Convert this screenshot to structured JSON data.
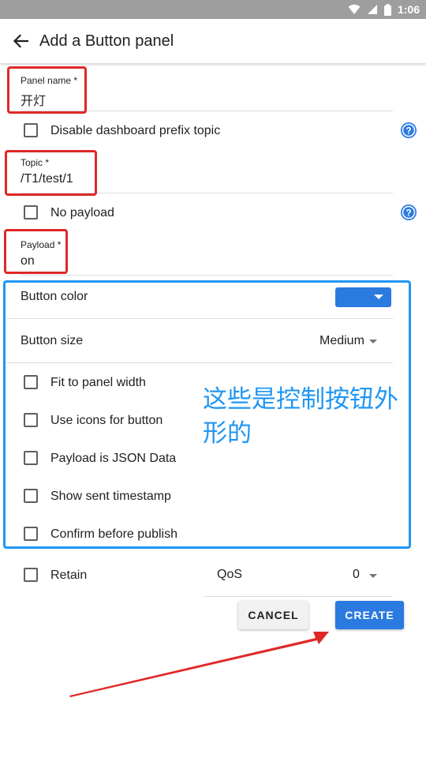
{
  "status_bar": {
    "time": "1:06",
    "icons": [
      "wifi-icon",
      "signal-icon",
      "battery-icon"
    ]
  },
  "app_bar": {
    "title": "Add a Button panel",
    "back_icon": "arrow-back-icon"
  },
  "form": {
    "panel_name": {
      "label": "Panel name *",
      "value": "开灯"
    },
    "disable_prefix": {
      "label": "Disable dashboard prefix topic",
      "checked": false
    },
    "topic": {
      "label": "Topic *",
      "value": "/T1/test/1"
    },
    "no_payload": {
      "label": "No payload",
      "checked": false
    },
    "payload": {
      "label": "Payload *",
      "value": "on"
    },
    "button_color": {
      "label": "Button color",
      "value_color": "#2b7ae0"
    },
    "button_size": {
      "label": "Button size",
      "value": "Medium"
    },
    "options": [
      {
        "label": "Fit to panel width",
        "checked": false
      },
      {
        "label": "Use icons for button",
        "checked": false
      },
      {
        "label": "Payload is JSON Data",
        "checked": false
      },
      {
        "label": "Show sent timestamp",
        "checked": false
      },
      {
        "label": "Confirm before publish",
        "checked": false
      }
    ],
    "retain": {
      "label": "Retain",
      "checked": false
    },
    "qos": {
      "label": "QoS",
      "value": "0"
    }
  },
  "actions": {
    "cancel": "CANCEL",
    "create": "CREATE"
  },
  "annotation": {
    "text": "这些是控制按钮外形的"
  },
  "colors": {
    "accent": "#2b7ae0",
    "highlight_red": "#e02828",
    "highlight_blue": "#2196f3",
    "help": "#2b7ae0"
  }
}
